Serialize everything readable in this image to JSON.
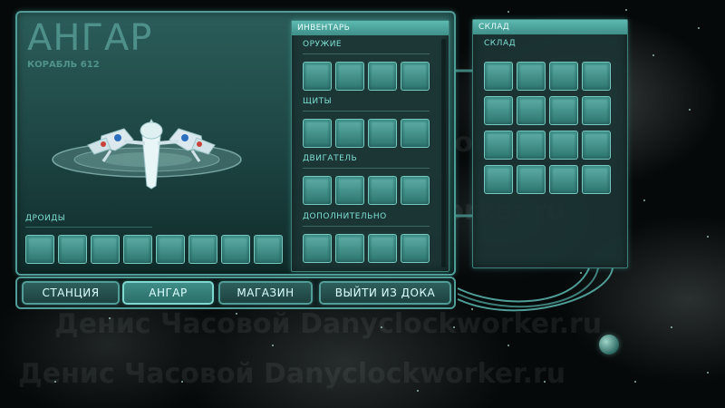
{
  "hangar": {
    "title": "АНГАР",
    "ship_name": "КОРАБЛЬ 612",
    "droids_label": "ДРОИДЫ",
    "droid_slots": 8
  },
  "inventory": {
    "header": "ИНВЕНТАРЬ",
    "sections": [
      {
        "label": "ОРУЖИЕ",
        "slots": 4
      },
      {
        "label": "ЩИТЫ",
        "slots": 4
      },
      {
        "label": "ДВИГАТЕЛЬ",
        "slots": 4
      },
      {
        "label": "ДОПОЛНИТЕЛЬНО",
        "slots": 4
      }
    ]
  },
  "storage": {
    "header": "СКЛАД",
    "label": "СКЛАД",
    "rows": 4,
    "cols": 4
  },
  "nav": {
    "station": "СТАНЦИЯ",
    "hangar": "АНГАР",
    "shop": "МАГАЗИН",
    "undock": "ВЫЙТИ ИЗ ДОКА"
  },
  "watermark": "Денис Часовой  Danyclockworker.ru",
  "colors": {
    "accent": "#4f9d96",
    "slot": "#3f8e88",
    "label": "#7fe0d4"
  }
}
